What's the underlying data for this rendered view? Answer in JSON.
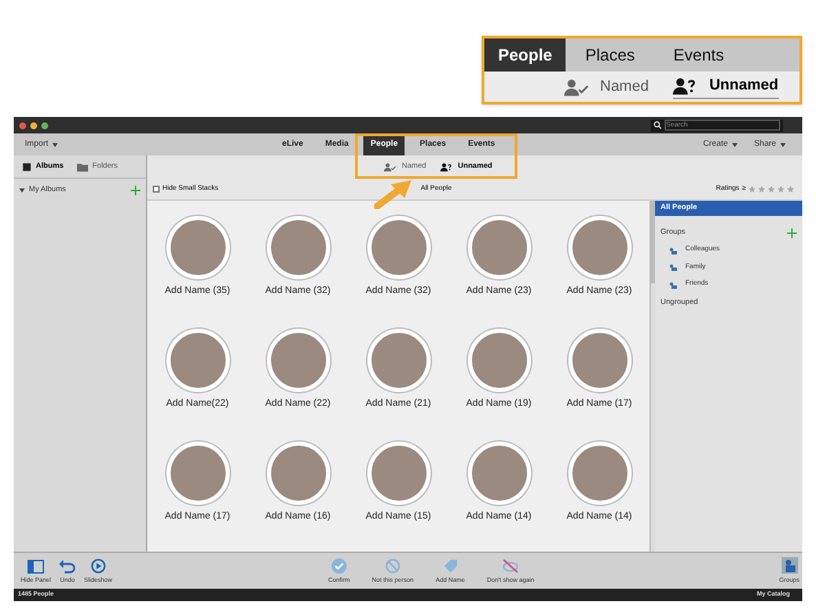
{
  "callout": {
    "tabs": [
      {
        "label": "People",
        "selected": true
      },
      {
        "label": "Places",
        "selected": false
      },
      {
        "label": "Events",
        "selected": false
      }
    ],
    "views": [
      {
        "label": "Named",
        "kind": "named",
        "selected": false
      },
      {
        "label": "Unnamed",
        "kind": "unnamed",
        "selected": true
      }
    ]
  },
  "window": {
    "search": {
      "placeholder": "Search"
    },
    "menu_left": "Import",
    "tabs": [
      {
        "label": "eLive",
        "selected": false
      },
      {
        "label": "Media",
        "selected": false
      },
      {
        "label": "People",
        "selected": true
      },
      {
        "label": "Places",
        "selected": false
      },
      {
        "label": "Events",
        "selected": false
      }
    ],
    "menu_right": [
      "Create",
      "Share"
    ],
    "panel_tabs": [
      {
        "label": "Albums",
        "kind": "albums",
        "selected": true
      },
      {
        "label": "Folders",
        "kind": "folders",
        "selected": false
      }
    ],
    "albums_heading": "My Albums",
    "views": [
      {
        "label": "Named",
        "kind": "named",
        "selected": false
      },
      {
        "label": "Unnamed",
        "kind": "unnamed",
        "selected": true
      }
    ],
    "hide_small_stacks": {
      "label": "Hide Small Stacks",
      "checked": false
    },
    "content_title": "All People",
    "ratings": {
      "label": "Ratings",
      "operator": "≥",
      "stars": 0
    },
    "people": [
      "Add Name (35)",
      "Add Name (32)",
      "Add Name (32)",
      "Add Name (23)",
      "Add Name (23)",
      "Add Name(22)",
      "Add Name (22)",
      "Add Name (21)",
      "Add Name (19)",
      "Add Name (17)",
      "Add Name (17)",
      "Add Name (16)",
      "Add Name (15)",
      "Add Name (14)",
      "Add Name (14)"
    ],
    "right_panel": {
      "all": {
        "label": "All People",
        "selected": true
      },
      "groups_heading": "Groups",
      "groups": [
        "Colleagues",
        "Family",
        "Friends"
      ],
      "ungrouped": "Ungrouped"
    },
    "toolbar_left": [
      {
        "label": "Hide Panel",
        "kind": "panel"
      },
      {
        "label": "Undo",
        "kind": "undo"
      },
      {
        "label": "Slideshow",
        "kind": "play"
      }
    ],
    "toolbar_center": [
      {
        "label": "Confirm",
        "kind": "confirm"
      },
      {
        "label": "Not this person",
        "kind": "no"
      },
      {
        "label": "Add Name",
        "kind": "tag"
      },
      {
        "label": "Don't show again",
        "kind": "hide"
      }
    ],
    "toolbar_right": {
      "label": "Groups"
    },
    "status_left": "1485 People",
    "status_right": "My Catalog"
  }
}
